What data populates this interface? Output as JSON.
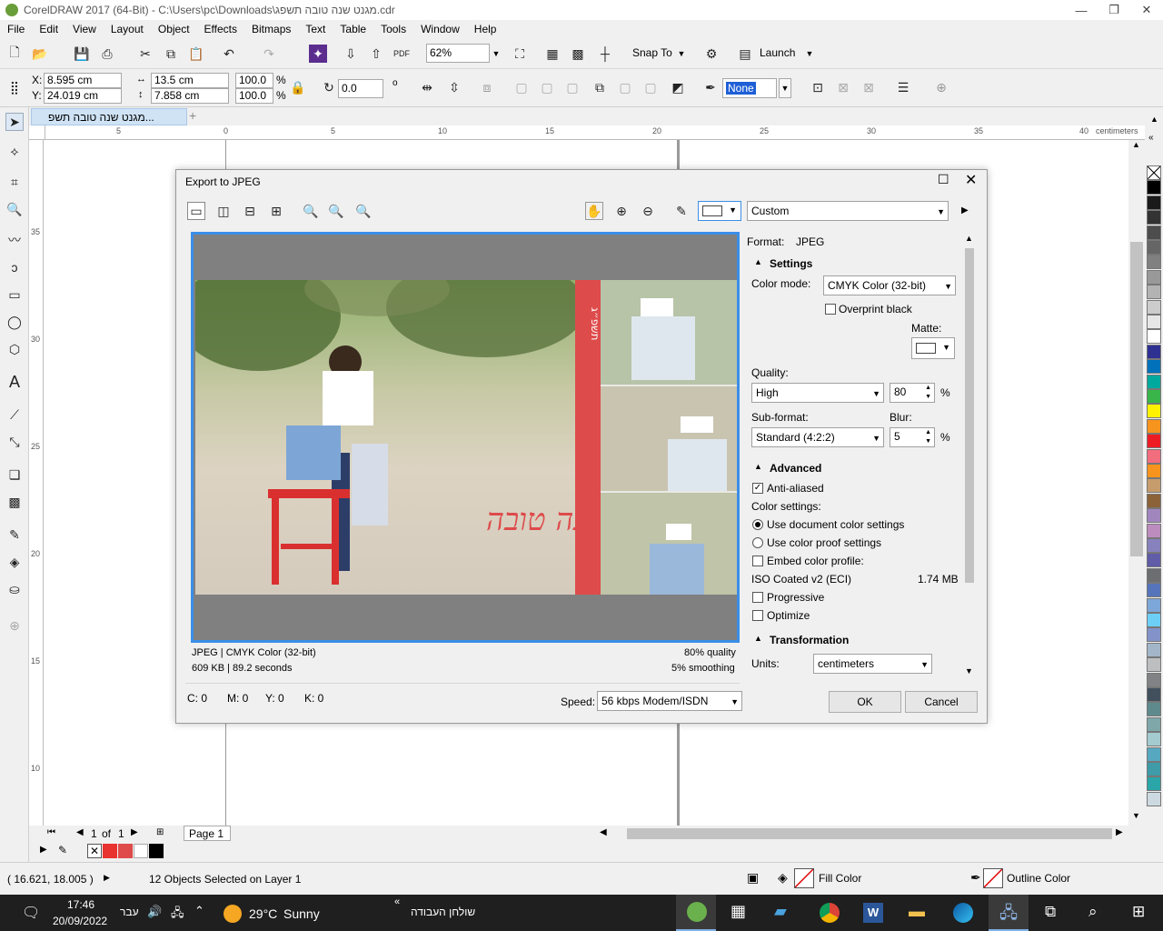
{
  "window": {
    "title": "CorelDRAW 2017 (64-Bit) - C:\\Users\\pc\\Downloads\\מגנט שנה טובה תשפג.cdr"
  },
  "menu": [
    "File",
    "Edit",
    "View",
    "Layout",
    "Object",
    "Effects",
    "Bitmaps",
    "Text",
    "Table",
    "Tools",
    "Window",
    "Help"
  ],
  "toolbar": {
    "zoom": "62%",
    "snap_to": "Snap To",
    "launch": "Launch"
  },
  "property_bar": {
    "x_label": "X:",
    "x_value": "8.595 cm",
    "y_label": "Y:",
    "y_value": "24.019 cm",
    "width_value": "13.5 cm",
    "height_value": "7.858 cm",
    "scale_w": "100.0",
    "scale_h": "100.0",
    "percent": "%",
    "rotation": "0.0",
    "degree": "o",
    "outline_width": "None"
  },
  "document_tab": {
    "label": "מגנט שנה טובה תשפ...",
    "add": "+"
  },
  "ruler": {
    "h_ticks": [
      "5",
      "0",
      "5",
      "10",
      "15",
      "20",
      "25",
      "30",
      "35",
      "40"
    ],
    "units": "centimeters",
    "v_ticks": [
      "35",
      "30",
      "25",
      "20",
      "15",
      "10"
    ]
  },
  "page_nav": {
    "current": "1",
    "of": "of",
    "total": "1",
    "page_tab": "Page 1"
  },
  "status": {
    "coords": "( 16.621, 18.005 )",
    "selection": "12 Objects Selected on Layer 1",
    "fill_label": "Fill Color",
    "outline_label": "Outline Color"
  },
  "taskbar": {
    "time": "17:46",
    "date": "20/09/2022",
    "lang": "עבר",
    "weather_temp": "29°C",
    "weather_desc": "Sunny",
    "desktop_label": "שולחן העבודה"
  },
  "dialog": {
    "title": "Export to JPEG",
    "preset": "Custom",
    "format_label": "Format:",
    "format_value": "JPEG",
    "settings_header": "Settings",
    "color_mode_label": "Color mode:",
    "color_mode_value": "CMYK Color (32-bit)",
    "overprint_black": "Overprint black",
    "matte_label": "Matte:",
    "quality_label": "Quality:",
    "quality_value": "High",
    "quality_num": "80",
    "percent": "%",
    "subformat_label": "Sub-format:",
    "subformat_value": "Standard (4:2:2)",
    "blur_label": "Blur:",
    "blur_num": "5",
    "advanced_header": "Advanced",
    "anti_aliased": "Anti-aliased",
    "color_settings_label": "Color settings:",
    "use_doc_color": "Use document color settings",
    "use_proof_color": "Use color proof settings",
    "embed_profile": "Embed color profile:",
    "profile_name": "ISO Coated v2 (ECI)",
    "profile_size": "1.74 MB",
    "progressive": "Progressive",
    "optimize": "Optimize",
    "transformation_header": "Transformation",
    "units_label": "Units:",
    "units_value": "centimeters",
    "info_format": "JPEG  |  CMYK Color (32-bit)",
    "info_size": "609 KB  |  89.2 seconds",
    "info_quality": "80% quality",
    "info_smoothing": "5% smoothing",
    "c": "C: 0",
    "m": "M: 0",
    "y": "Y: 0",
    "k": "K: 0",
    "speed_label": "Speed:",
    "speed_value": "56 kbps Modem/ISDN",
    "ok": "OK",
    "cancel": "Cancel",
    "photo_banner": "שנה טובה",
    "side_text": "תשפ״ג"
  },
  "palette_colors": [
    "#ffffff",
    "#000000",
    "#1a1a1a",
    "#333333",
    "#4d4d4d",
    "#666666",
    "#808080",
    "#999999",
    "#b3b3b3",
    "#cccccc",
    "#e6e6e6",
    "#ffffff",
    "#2e3192",
    "#0072bc",
    "#00a99d",
    "#39b54a",
    "#fff200",
    "#f7941d",
    "#ed1c24",
    "#f26d7d",
    "#f7941d",
    "#c69c6d",
    "#8c6239",
    "#a186be",
    "#bd8cbf",
    "#8781bd",
    "#605ca8",
    "#6d6e71",
    "#5674b9",
    "#7da7d9",
    "#6dcff6",
    "#8393ca",
    "#a3b6c9",
    "#bcbec0",
    "#808285",
    "#41505c",
    "#5e8a8d",
    "#7fa7a9",
    "#a4cbd0",
    "#56a8c0",
    "#3f9ba8",
    "#2aa5a8",
    "#ccd9e0"
  ]
}
